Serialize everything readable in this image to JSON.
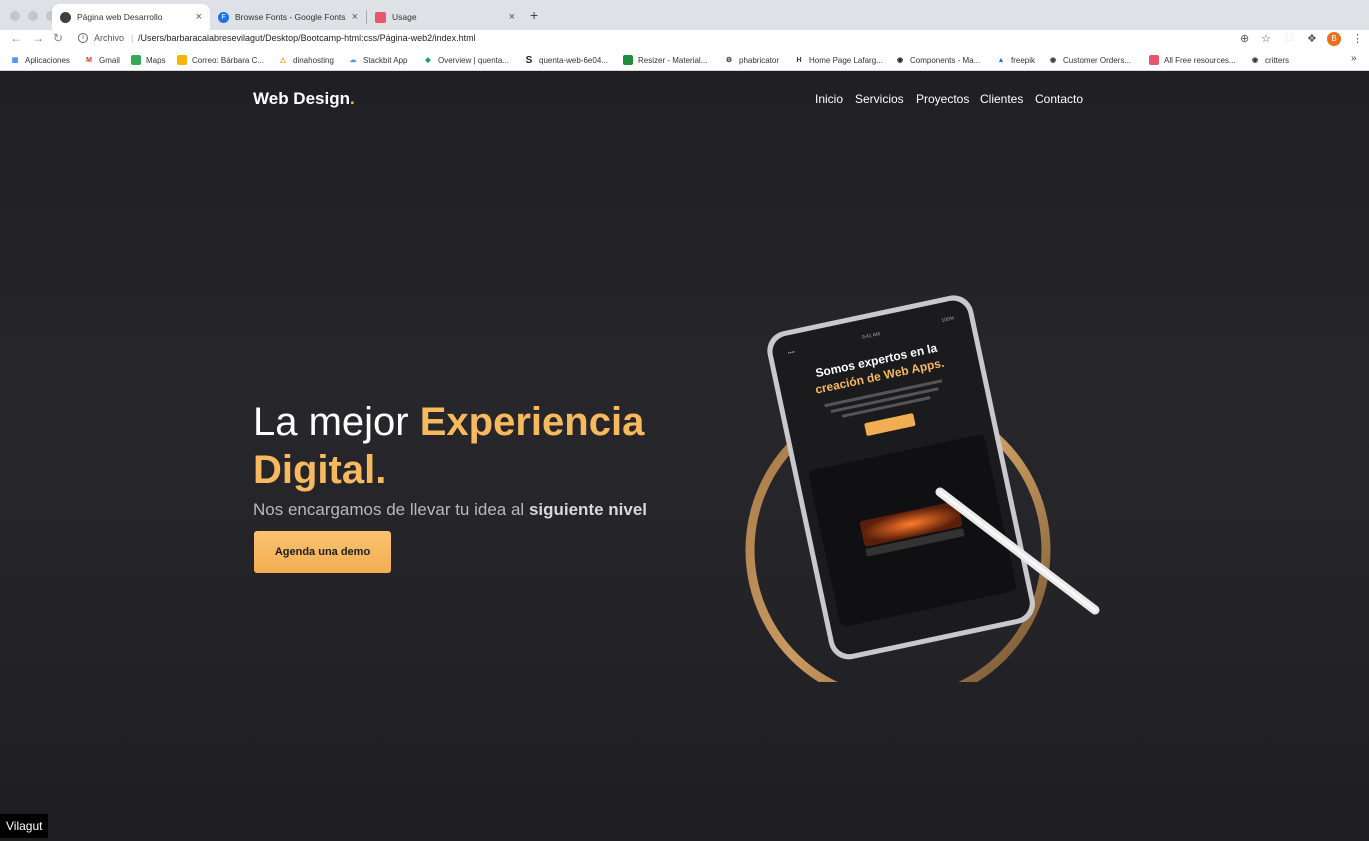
{
  "browser": {
    "tabs": [
      {
        "title": "Página web Desarrollo",
        "active": true,
        "favicon_color": "#3c4043"
      },
      {
        "title": "Browse Fonts - Google Fonts",
        "active": false,
        "favicon_color": "#1a73e8"
      },
      {
        "title": "Usage",
        "active": false,
        "favicon_color": "#e8566c"
      }
    ],
    "new_tab_label": "+",
    "close_glyph": "×",
    "url_scheme": "Archivo",
    "url_separator": "|",
    "url": "/Users/barbaracalabresevilagut/Desktop/Bootcamp-html:css/Página-web2/index.html",
    "profile_initial": "B",
    "bookmarks": [
      {
        "label": "Aplicaciones",
        "icon": "apps-grid-icon"
      },
      {
        "label": "Gmail",
        "icon": "gmail-icon"
      },
      {
        "label": "Maps",
        "icon": "maps-icon"
      },
      {
        "label": "Correo: Bárbara C...",
        "icon": "outlook-icon"
      },
      {
        "label": "dinahosting",
        "icon": "dinahosting-icon"
      },
      {
        "label": "Stackbit App",
        "icon": "stackbit-icon"
      },
      {
        "label": "Overview | quenta...",
        "icon": "overview-icon"
      },
      {
        "label": "quenta-web-6e04...",
        "icon": "quenta-icon"
      },
      {
        "label": "Resizer - Material...",
        "icon": "resizer-icon"
      },
      {
        "label": "phabricator",
        "icon": "phabricator-icon"
      },
      {
        "label": "Home Page Lafarg...",
        "icon": "lafarge-icon"
      },
      {
        "label": "Components - Ma...",
        "icon": "github-icon"
      },
      {
        "label": "freepik",
        "icon": "freepik-icon"
      },
      {
        "label": "Customer Orders...",
        "icon": "globe-icon"
      },
      {
        "label": "All Free resources...",
        "icon": "resources-icon"
      },
      {
        "label": "critters",
        "icon": "globe-icon"
      }
    ],
    "bookmarks_more": "»"
  },
  "site": {
    "brand": "Web Design",
    "brand_dot": ".",
    "nav": [
      "Inicio",
      "Servicios",
      "Proyectos",
      "Clientes",
      "Contacto"
    ],
    "hero": {
      "title_plain": "La mejor ",
      "title_accent": "Experiencia Digital.",
      "subtitle_plain": "Nos encargamos de llevar tu idea al ",
      "subtitle_bold": "siguiente nivel",
      "cta_label": "Agenda una demo"
    },
    "tablet": {
      "headline_1": "Somos expertos en la",
      "headline_2": "creación de Web Apps.",
      "time": "9:41 AM",
      "battery": "100%"
    },
    "accent_color": "#f7b95e",
    "background_color": "#222226"
  },
  "overlay": {
    "watermark": "Vilagut"
  }
}
